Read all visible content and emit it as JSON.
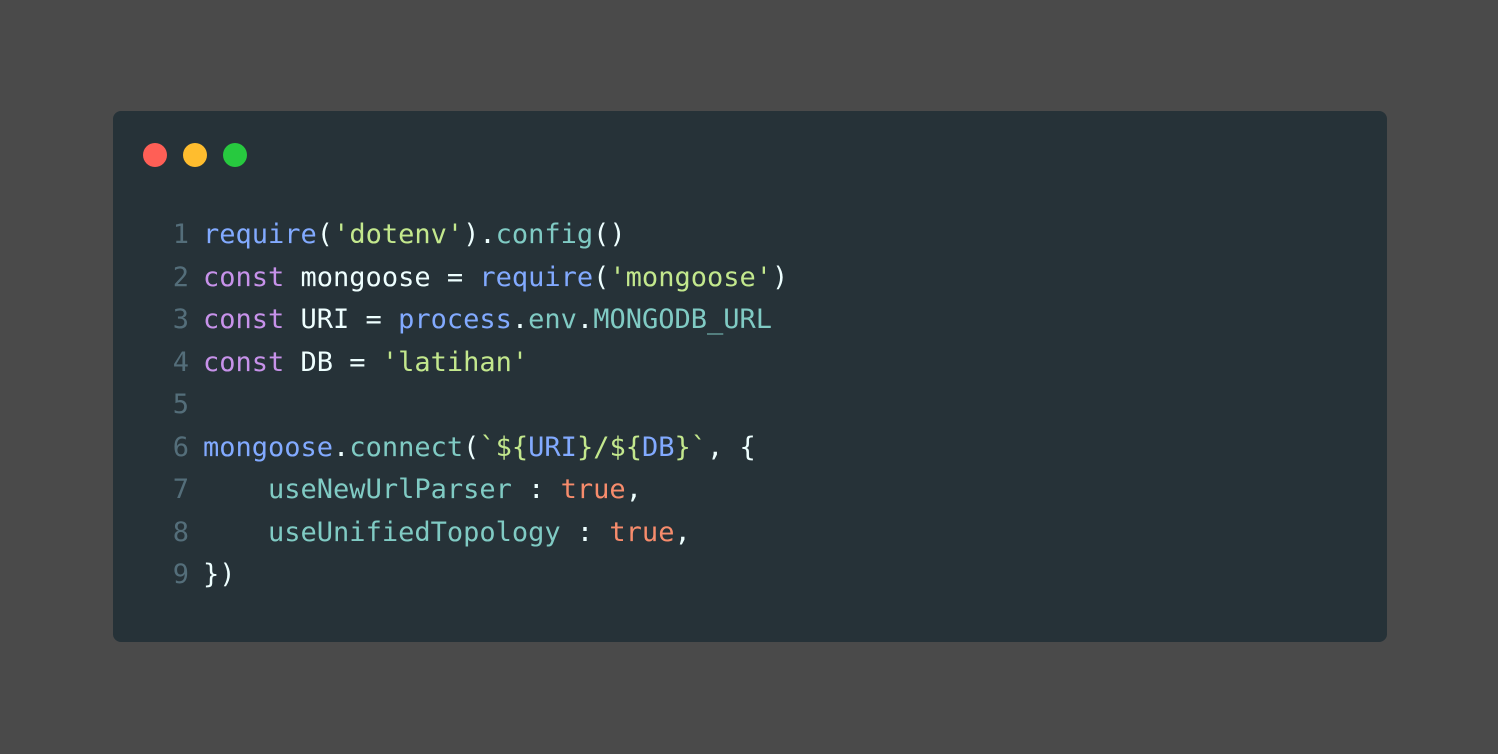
{
  "window": {
    "controls": [
      {
        "name": "close",
        "color": "#ff5f56"
      },
      {
        "name": "minimize",
        "color": "#ffbd2e"
      },
      {
        "name": "maximize",
        "color": "#27c93f"
      }
    ]
  },
  "colors": {
    "background": "#4a4a4a",
    "editor_bg": "#263238",
    "line_number": "#546e7a",
    "plain": "#eeffff",
    "function": "#82aaff",
    "string": "#c3e88d",
    "keyword": "#c792ea",
    "property": "#80cbc4",
    "boolean": "#f78c6c"
  },
  "code": {
    "lines": [
      {
        "number": "1",
        "tokens": [
          {
            "text": "require",
            "kind": "function"
          },
          {
            "text": "(",
            "kind": "plain"
          },
          {
            "text": "'dotenv'",
            "kind": "string"
          },
          {
            "text": ").",
            "kind": "plain"
          },
          {
            "text": "config",
            "kind": "property"
          },
          {
            "text": "()",
            "kind": "plain"
          }
        ]
      },
      {
        "number": "2",
        "tokens": [
          {
            "text": "const",
            "kind": "keyword"
          },
          {
            "text": " mongoose = ",
            "kind": "plain"
          },
          {
            "text": "require",
            "kind": "function"
          },
          {
            "text": "(",
            "kind": "plain"
          },
          {
            "text": "'mongoose'",
            "kind": "string"
          },
          {
            "text": ")",
            "kind": "plain"
          }
        ]
      },
      {
        "number": "3",
        "tokens": [
          {
            "text": "const",
            "kind": "keyword"
          },
          {
            "text": " URI = ",
            "kind": "plain"
          },
          {
            "text": "process",
            "kind": "function"
          },
          {
            "text": ".",
            "kind": "plain"
          },
          {
            "text": "env",
            "kind": "property"
          },
          {
            "text": ".",
            "kind": "plain"
          },
          {
            "text": "MONGODB_URL",
            "kind": "property"
          }
        ]
      },
      {
        "number": "4",
        "tokens": [
          {
            "text": "const",
            "kind": "keyword"
          },
          {
            "text": " DB = ",
            "kind": "plain"
          },
          {
            "text": "'latihan'",
            "kind": "string"
          }
        ]
      },
      {
        "number": "5",
        "tokens": []
      },
      {
        "number": "6",
        "tokens": [
          {
            "text": "mongoose",
            "kind": "function"
          },
          {
            "text": ".",
            "kind": "plain"
          },
          {
            "text": "connect",
            "kind": "property"
          },
          {
            "text": "(",
            "kind": "plain"
          },
          {
            "text": "`${",
            "kind": "string"
          },
          {
            "text": "URI",
            "kind": "function"
          },
          {
            "text": "}/${",
            "kind": "string"
          },
          {
            "text": "DB",
            "kind": "function"
          },
          {
            "text": "}`",
            "kind": "string"
          },
          {
            "text": ", {",
            "kind": "plain"
          }
        ]
      },
      {
        "number": "7",
        "tokens": [
          {
            "text": "    ",
            "kind": "plain"
          },
          {
            "text": "useNewUrlParser",
            "kind": "property"
          },
          {
            "text": " : ",
            "kind": "plain"
          },
          {
            "text": "true",
            "kind": "boolean"
          },
          {
            "text": ",",
            "kind": "plain"
          }
        ]
      },
      {
        "number": "8",
        "tokens": [
          {
            "text": "    ",
            "kind": "plain"
          },
          {
            "text": "useUnifiedTopology",
            "kind": "property"
          },
          {
            "text": " : ",
            "kind": "plain"
          },
          {
            "text": "true",
            "kind": "boolean"
          },
          {
            "text": ",",
            "kind": "plain"
          }
        ]
      },
      {
        "number": "9",
        "tokens": [
          {
            "text": "})",
            "kind": "plain"
          }
        ]
      }
    ]
  }
}
